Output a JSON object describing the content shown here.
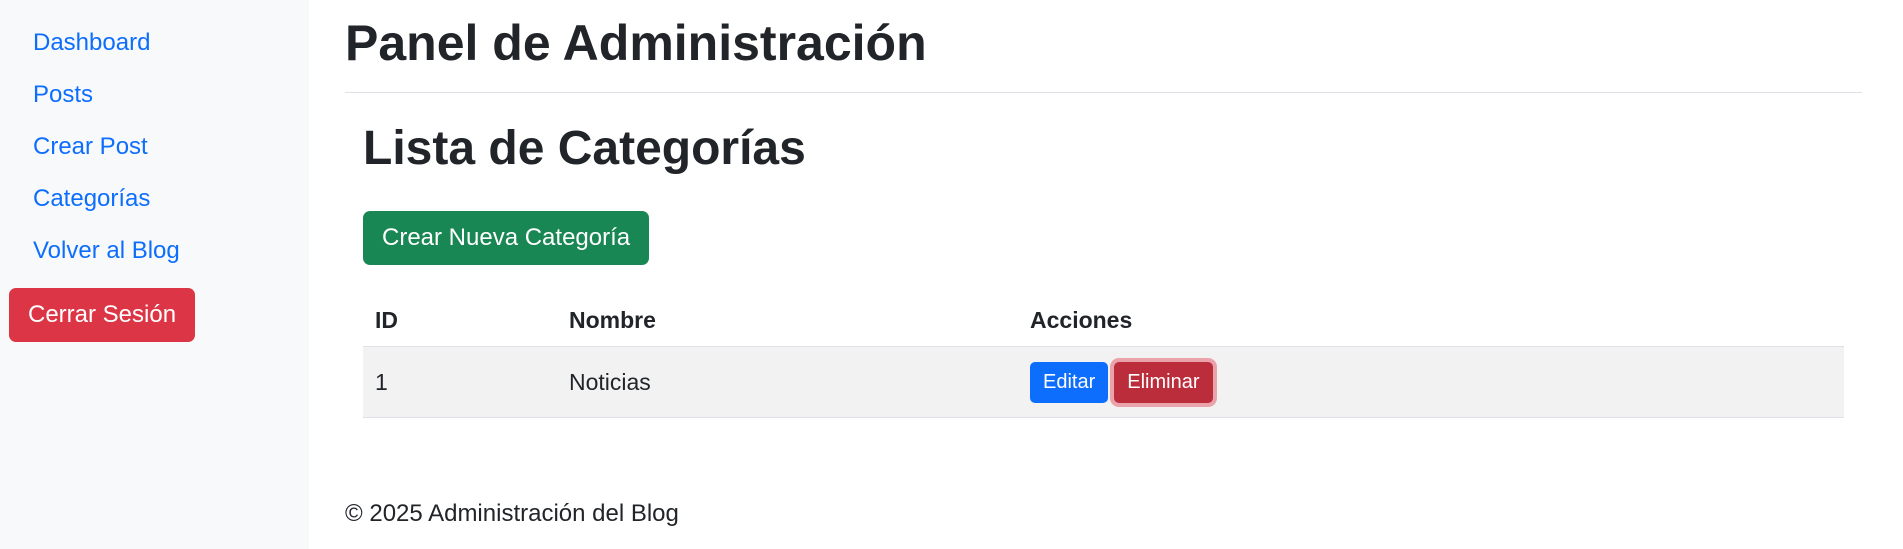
{
  "sidebar": {
    "items": [
      {
        "label": "Dashboard"
      },
      {
        "label": "Posts"
      },
      {
        "label": "Crear Post"
      },
      {
        "label": "Categorías"
      },
      {
        "label": "Volver al Blog"
      }
    ],
    "logout_label": "Cerrar Sesión"
  },
  "header": {
    "title": "Panel de Administración"
  },
  "main": {
    "section_title": "Lista de Categorías",
    "create_button_label": "Crear Nueva Categoría",
    "table": {
      "columns": [
        "ID",
        "Nombre",
        "Acciones"
      ],
      "rows": [
        {
          "id": "1",
          "name": "Noticias",
          "edit_label": "Editar",
          "delete_label": "Eliminar"
        }
      ]
    }
  },
  "footer": {
    "text": "© 2025 Administración del Blog"
  },
  "colors": {
    "link": "#0d6efd",
    "danger": "#dc3545",
    "success": "#198754",
    "sidebar_bg": "#f8f9fa"
  }
}
